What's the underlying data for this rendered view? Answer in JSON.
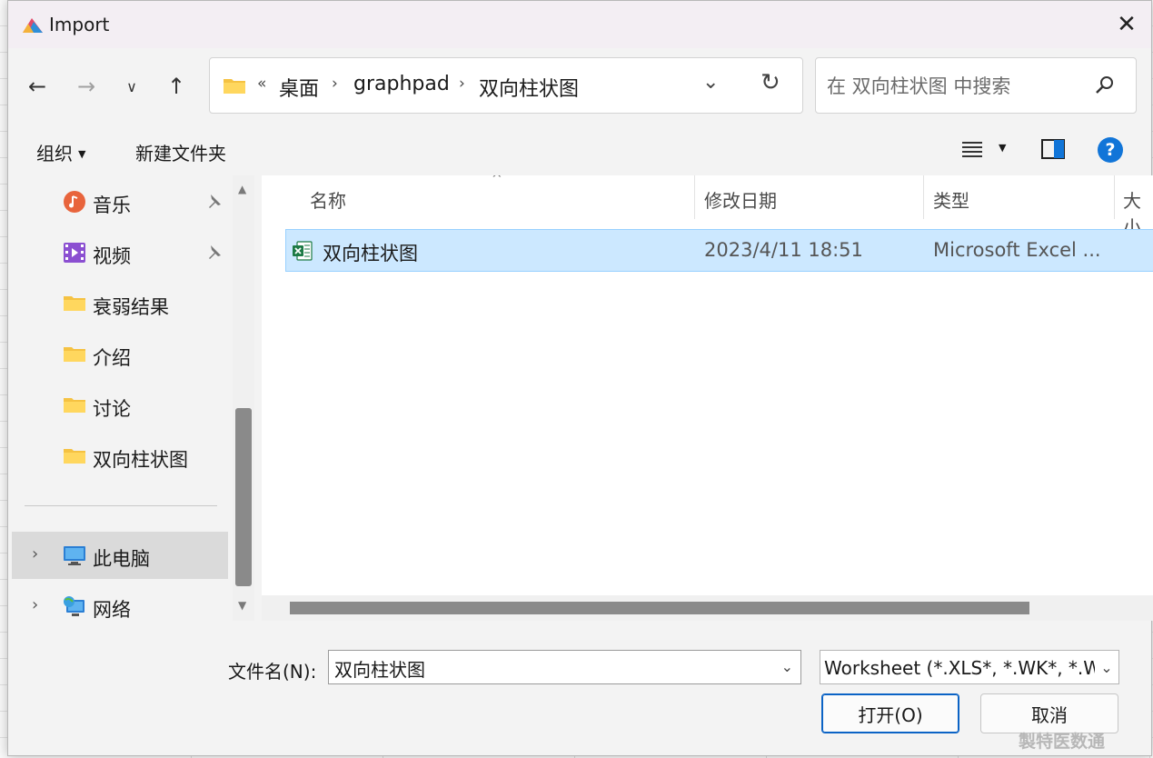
{
  "window": {
    "title": "Import"
  },
  "nav": {
    "breadcrumb": [
      "桌面",
      "graphpad",
      "双向柱状图"
    ],
    "breadcrumb_prefix": "«"
  },
  "search": {
    "placeholder": "在 双向柱状图 中搜索"
  },
  "toolbar": {
    "organize": "组织",
    "new_folder": "新建文件夹"
  },
  "sidebar": {
    "items": [
      {
        "label": "音乐",
        "icon": "music-icon",
        "pinned": true
      },
      {
        "label": "视频",
        "icon": "video-icon",
        "pinned": true
      },
      {
        "label": "衰弱结果",
        "icon": "folder-icon"
      },
      {
        "label": "介绍",
        "icon": "folder-icon"
      },
      {
        "label": "讨论",
        "icon": "folder-icon"
      },
      {
        "label": "双向柱状图",
        "icon": "folder-icon"
      },
      {
        "label": "此电脑",
        "icon": "computer-icon",
        "selected": true
      },
      {
        "label": "网络",
        "icon": "network-icon"
      }
    ]
  },
  "filelist": {
    "columns": [
      "名称",
      "修改日期",
      "类型",
      "大小"
    ],
    "rows": [
      {
        "name": "双向柱状图",
        "modified": "2023/4/11 18:51",
        "type": "Microsoft Excel ...",
        "icon": "excel-icon",
        "selected": true
      }
    ]
  },
  "bottom": {
    "filename_label": "文件名(N):",
    "filename_value": "双向柱状图",
    "filetype_value": "Worksheet (*.XLS*, *.WK*, *.W",
    "open_label": "打开(O)",
    "cancel_label": "取消"
  },
  "watermark": "製特医数通",
  "colors": {
    "accent": "#0b63c5",
    "selection": "#cce8ff",
    "help": "#1175d8"
  }
}
